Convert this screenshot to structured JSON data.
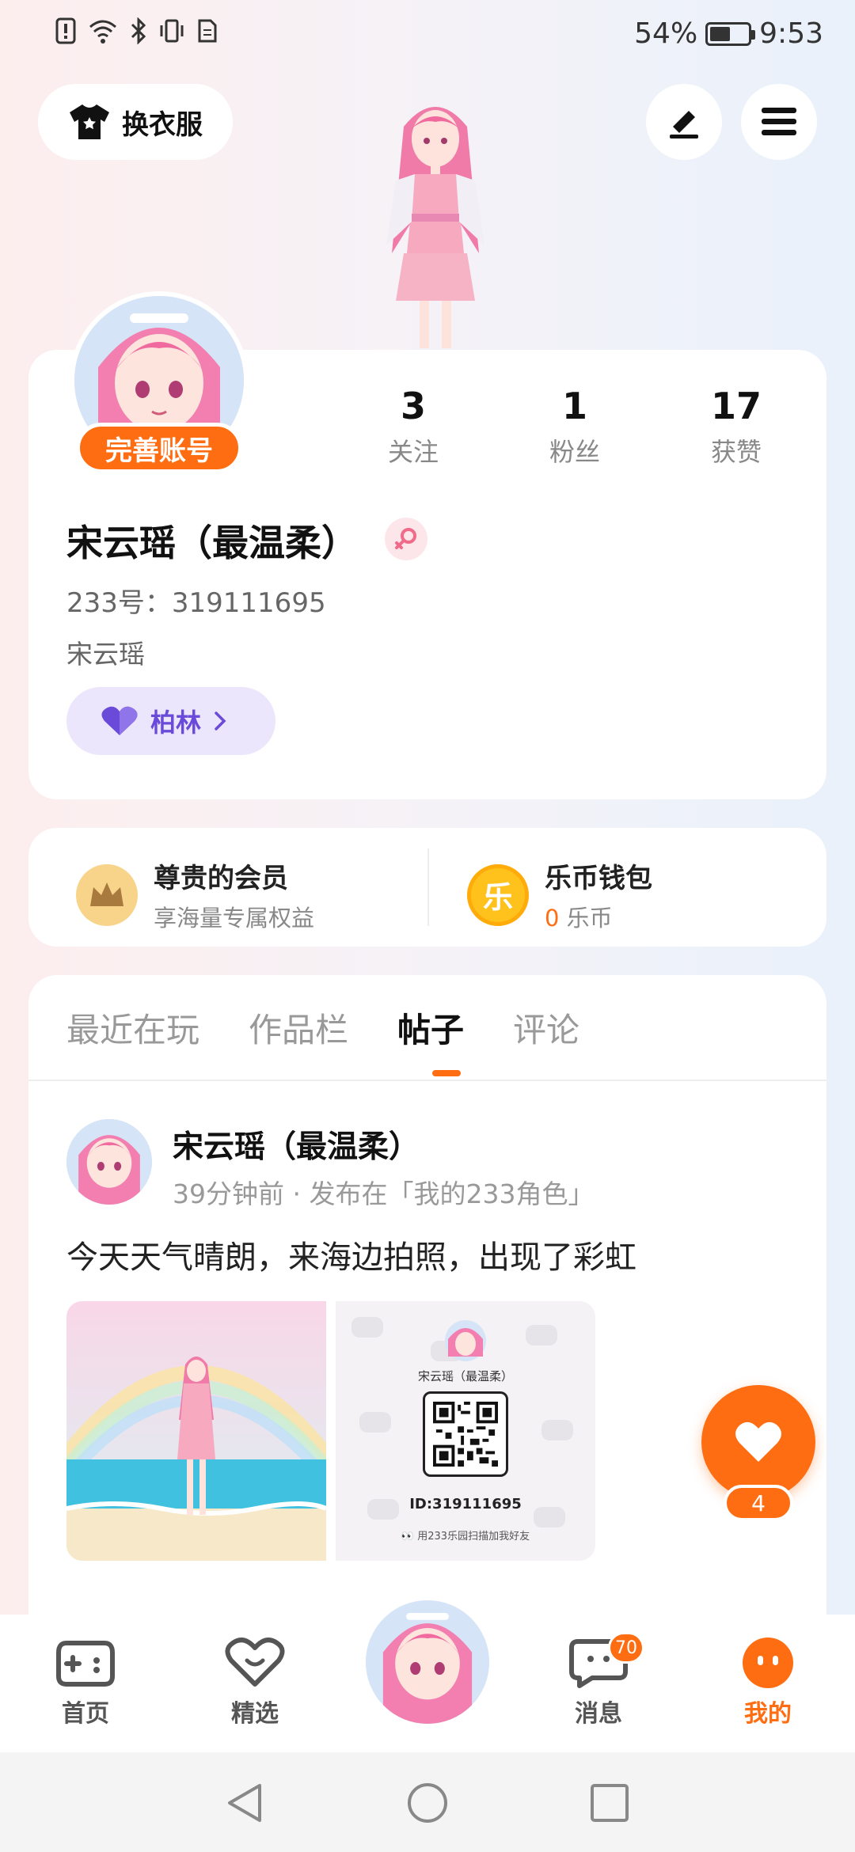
{
  "status_bar": {
    "battery": "54%",
    "battery_level": 0.54,
    "time": "9:53"
  },
  "top_bar": {
    "outfit_label": "换衣服"
  },
  "profile": {
    "complete_badge": "完善账号",
    "stats": [
      {
        "value": "3",
        "label": "关注"
      },
      {
        "value": "1",
        "label": "粉丝"
      },
      {
        "value": "17",
        "label": "获赞"
      }
    ],
    "name": "宋云瑶（最温柔）",
    "uid": "233号：319111695",
    "nickname": "宋云瑶",
    "family_label": "柏林"
  },
  "member": {
    "vip_title": "尊贵的会员",
    "vip_sub": "享海量专属权益",
    "wallet_title": "乐币钱包",
    "wallet_amount": "0",
    "wallet_unit": "乐币",
    "coin_glyph": "乐"
  },
  "tabs": [
    "最近在玩",
    "作品栏",
    "帖子",
    "评论"
  ],
  "post": {
    "author": "宋云瑶（最温柔）",
    "meta": "39分钟前 · 发布在「我的233角色」",
    "text": "今天天气晴朗，来海边拍照，出现了彩虹",
    "qr_name": "宋云瑶（最温柔）",
    "qr_id": "ID:319111695",
    "qr_tip": "用233乐园扫描加我好友"
  },
  "like_count": "4",
  "bottom_nav": {
    "items": [
      {
        "label": "首页"
      },
      {
        "label": "精选"
      },
      {
        "label": "消息"
      },
      {
        "label": "我的"
      }
    ],
    "message_badge": "70"
  },
  "colors": {
    "accent": "#ff6d12",
    "purple": "#6a4ad8"
  }
}
